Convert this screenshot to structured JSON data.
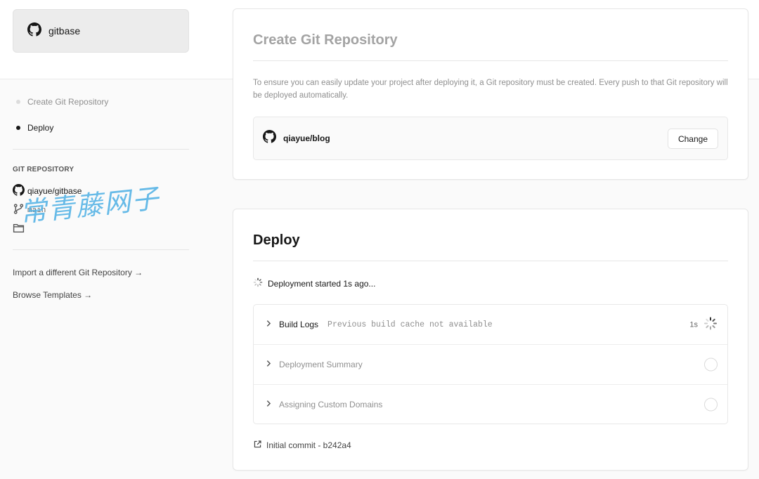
{
  "brand": {
    "name": "gitbase",
    "icon": "github-icon"
  },
  "steps": [
    {
      "label": "Create Git Repository",
      "state": "done"
    },
    {
      "label": "Deploy",
      "state": "active"
    }
  ],
  "git_repository": {
    "section_label": "GIT REPOSITORY",
    "repo": "qiayue/gitbase",
    "branch": "main"
  },
  "links": {
    "import": "Import a different Git Repository →",
    "templates": "Browse Templates →"
  },
  "watermark": "常青藤网子",
  "create_card": {
    "title": "Create Git Repository",
    "description": "To ensure you can easily update your project after deploying it, a Git repository must be created. Every push to that Git repository will be deployed automatically.",
    "repo": "qiayue/blog",
    "change_label": "Change"
  },
  "deploy_card": {
    "title": "Deploy",
    "status": "Deployment started 1s ago...",
    "steps": [
      {
        "title": "Build Logs",
        "subtitle": "Previous build cache not available",
        "time": "1s",
        "state": "running"
      },
      {
        "title": "Deployment Summary",
        "subtitle": "",
        "time": "",
        "state": "pending"
      },
      {
        "title": "Assigning Custom Domains",
        "subtitle": "",
        "time": "",
        "state": "pending"
      }
    ],
    "commit": "Initial commit - b242a4"
  }
}
